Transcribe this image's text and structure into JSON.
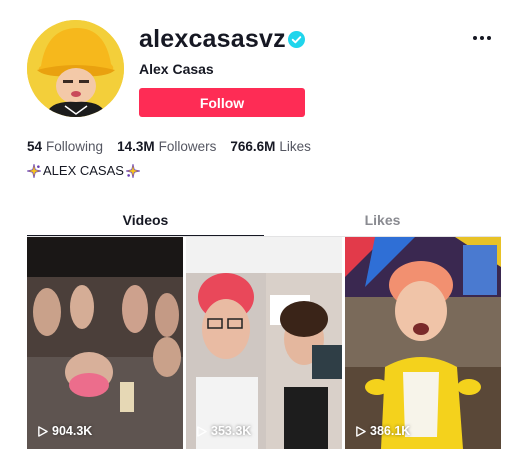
{
  "profile": {
    "username": "alexcasasvz",
    "display_name": "Alex Casas",
    "follow_label": "Follow",
    "bio": "ALEX CASAS"
  },
  "stats": {
    "following": {
      "count": "54",
      "label": "Following"
    },
    "followers": {
      "count": "14.3M",
      "label": "Followers"
    },
    "likes": {
      "count": "766.6M",
      "label": "Likes"
    }
  },
  "tabs": [
    {
      "label": "Videos",
      "active": true
    },
    {
      "label": "Likes",
      "active": false
    }
  ],
  "videos": [
    {
      "views": "904.3K"
    },
    {
      "views": "353.3K"
    },
    {
      "views": "386.1K"
    }
  ],
  "colors": {
    "accent": "#fe2c55",
    "verified": "#20d5ec",
    "text_primary": "#161823",
    "text_secondary": "#545661"
  },
  "icons": [
    "verified-badge-icon",
    "more-options-icon",
    "sparkle-icon",
    "play-icon"
  ]
}
